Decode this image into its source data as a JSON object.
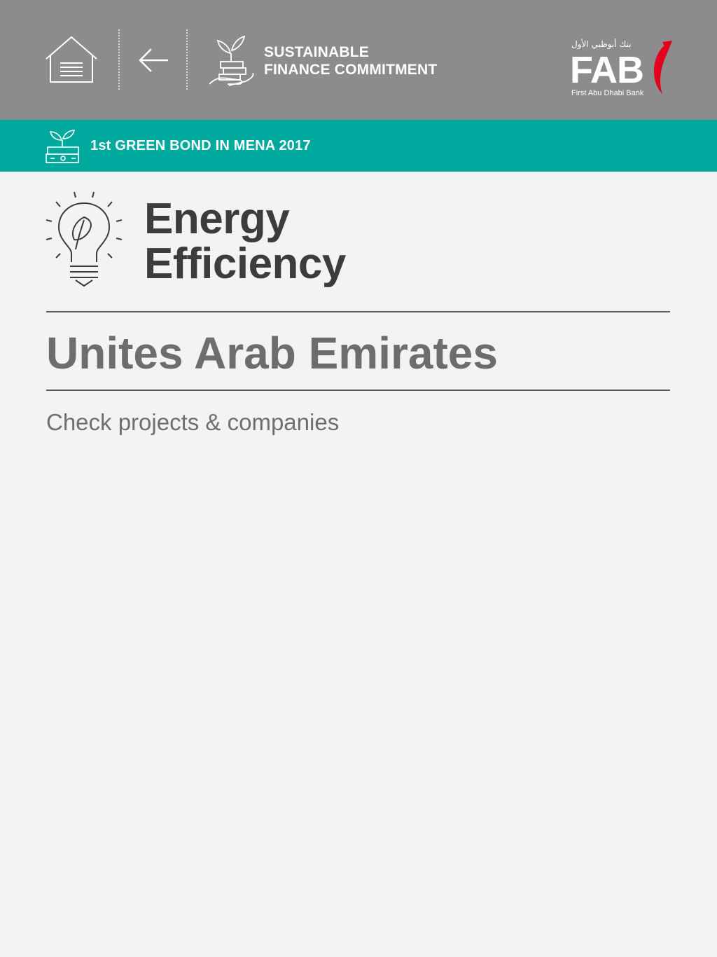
{
  "header": {
    "section_title_line1": "SUSTAINABLE",
    "section_title_line2": "FINANCE COMMITMENT",
    "logo": {
      "arabic": "بنك أبوظبي الأول",
      "mark": "FAB",
      "name": "First Abu Dhabi Bank"
    },
    "icons": [
      "home-icon",
      "back-arrow-icon",
      "sustainable-finance-icon",
      "fab-logo"
    ]
  },
  "banner": {
    "text": "1st GREEN BOND IN MENA 2017",
    "icon": "green-bond-icon"
  },
  "category": {
    "icon": "lightbulb-leaf-icon",
    "title_line1": "Energy",
    "title_line2": "Efficiency"
  },
  "country": "Unites Arab Emirates",
  "link": "Check projects & companies",
  "colors": {
    "header_bg": "#8c8c8c",
    "banner_bg": "#00a99d",
    "page_bg": "#f3f3f3",
    "title_text": "#3c3c3c",
    "country_text": "#6d6d6d",
    "logo_accent": "#e4001b"
  }
}
